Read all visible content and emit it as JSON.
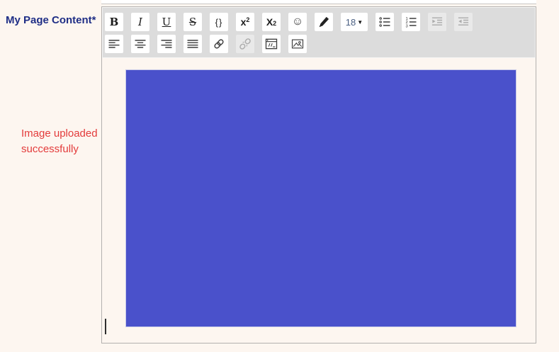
{
  "colors": {
    "page_background": "#FDF6F0",
    "toolbar_background": "#DCDCDC",
    "editor_border": "#B3B1AF",
    "label_color": "#1F2E86",
    "status_color": "#E33B3B",
    "uploaded_image_fill": "#4A51CB"
  },
  "field": {
    "label": "My Page Content*"
  },
  "status": {
    "message": "Image uploaded successfully"
  },
  "toolbar": {
    "bold": "B",
    "italic": "I",
    "underline": "U",
    "strikethrough": "S",
    "code_braces": "{}",
    "superscript": {
      "base": "x",
      "script": "2"
    },
    "subscript": {
      "base": "X",
      "script": "2"
    },
    "emoji_face": "☺",
    "font_size": {
      "value": "18",
      "arrow": "▼"
    },
    "icons": {
      "pen": "svg-pen",
      "bulleted_list": "svg-list-bullets",
      "numbered_list": "svg-list-numbers",
      "indent": "svg-indent-right (disabled)",
      "outdent": "svg-indent-left (disabled)",
      "align_left": "svg-align-left",
      "align_center": "svg-align-center",
      "align_right": "svg-align-right",
      "justify": "svg-justify",
      "link": "svg-chain",
      "unlink": "svg-chain-broken (disabled)",
      "source_window": "svg-window-code",
      "image": "svg-picture"
    }
  },
  "editor_content": {
    "uploaded_image": "solid blue image",
    "caret": "text insertion caret below image"
  }
}
